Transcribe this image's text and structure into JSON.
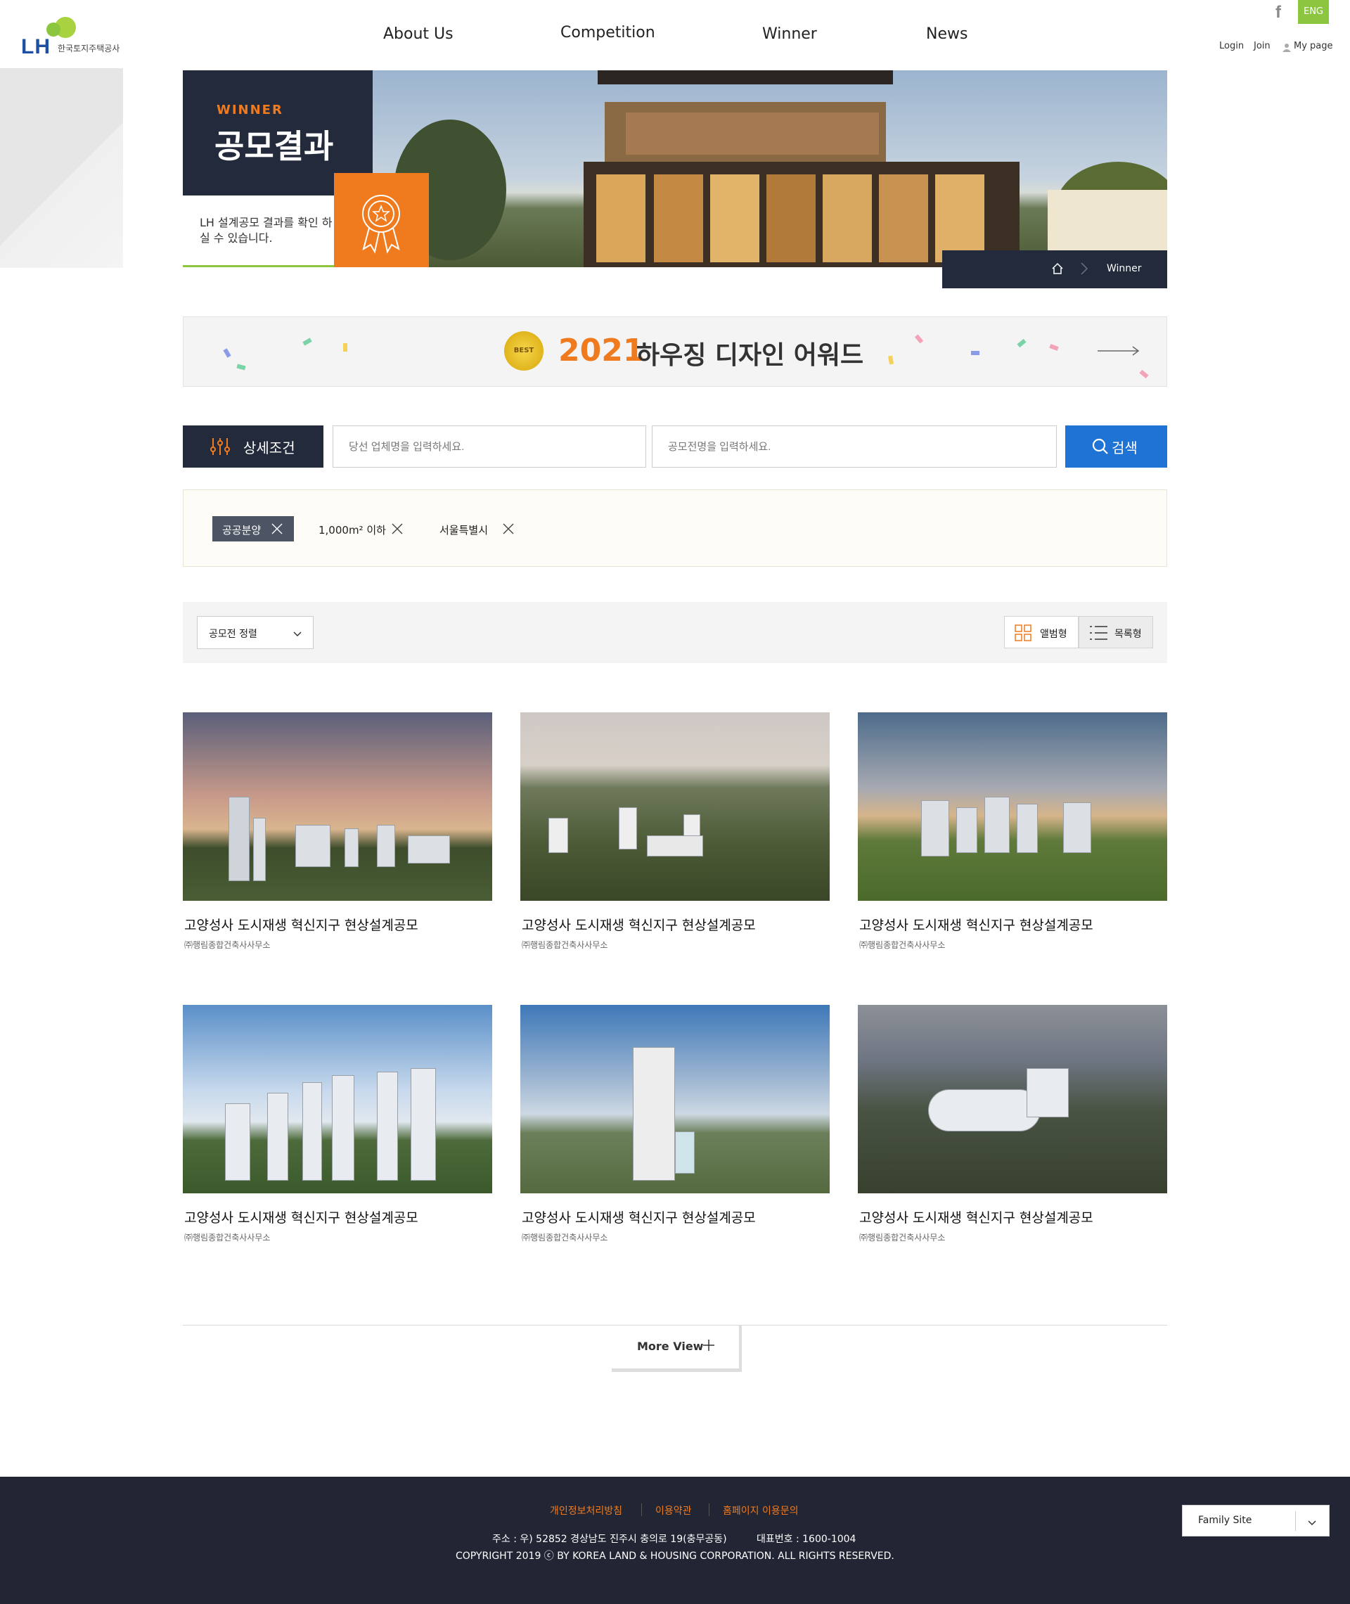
{
  "header": {
    "logo_text": "LH",
    "logo_sub": "한국토지주택공사",
    "nav": [
      "About Us",
      "Competition",
      "Winner",
      "News"
    ],
    "lang": "ENG",
    "util": [
      "Login",
      "Join",
      "My page"
    ]
  },
  "hero": {
    "eyebrow": "WINNER",
    "title": "공모결과",
    "desc": "LH 설계공모 결과를 확인 하실 수 있습니다.",
    "breadcrumb": "Winner"
  },
  "award": {
    "badge": "BEST",
    "year": "2021",
    "text": "하우징 디자인 어워드"
  },
  "search": {
    "detail_label": "상세조건",
    "company_placeholder": "당선 업체명을 입력하세요.",
    "contest_placeholder": "공모전명을 입력하세요.",
    "button": "검색"
  },
  "filters": [
    "공공분양",
    "1,000m² 이하",
    "서울특별시"
  ],
  "sort": {
    "label": "공모전 정렬",
    "album": "앨범형",
    "list": "목록형"
  },
  "cards": [
    {
      "title": "고양성사 도시재생 혁신지구 현상설계공모",
      "company": "㈜행림종합건축사사무소"
    },
    {
      "title": "고양성사 도시재생 혁신지구 현상설계공모",
      "company": "㈜행림종합건축사사무소"
    },
    {
      "title": "고양성사 도시재생 혁신지구 현상설계공모",
      "company": "㈜행림종합건축사사무소"
    },
    {
      "title": "고양성사 도시재생 혁신지구 현상설계공모",
      "company": "㈜행림종합건축사사무소"
    },
    {
      "title": "고양성사 도시재생 혁신지구 현상설계공모",
      "company": "㈜행림종합건축사사무소"
    },
    {
      "title": "고양성사 도시재생 혁신지구 현상설계공모",
      "company": "㈜행림종합건축사사무소"
    }
  ],
  "more": "More View",
  "footer": {
    "links": [
      "개인정보처리방침",
      "이용약관",
      "홈페이지 이용문의"
    ],
    "address": "주소 : 우) 52852 경상남도 진주시 충의로 19(충무공동)",
    "phone": "대표번호 : 1600-1004",
    "copyright": "COPYRIGHT 2019 ⓒ BY KOREA LAND & HOUSING CORPORATION. ALL RIGHTS RESERVED.",
    "family": "Family Site"
  }
}
